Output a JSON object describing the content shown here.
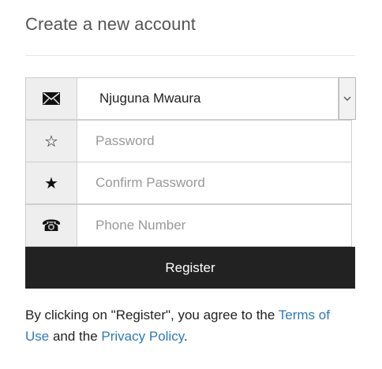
{
  "page": {
    "title": "Create a new account"
  },
  "form": {
    "name_value": "Njuguna Mwaura",
    "password_placeholder": "Password",
    "confirm_password_placeholder": "Confirm Password",
    "phone_placeholder": "Phone Number",
    "register_label": "Register"
  },
  "icons": {
    "name_icon": "envelope-icon",
    "password_icon": "star-outline-icon",
    "confirm_icon": "star-filled-icon",
    "phone_icon": "phone-icon"
  },
  "terms": {
    "prefix": "By clicking on \"Register\", you agree to the ",
    "terms_link": "Terms of Use",
    "middle": " and the ",
    "privacy_link": "Privacy Policy",
    "suffix": "."
  },
  "colors": {
    "button_bg": "#222222",
    "link": "#2e7ab8",
    "addon_bg": "#eeeeee"
  }
}
